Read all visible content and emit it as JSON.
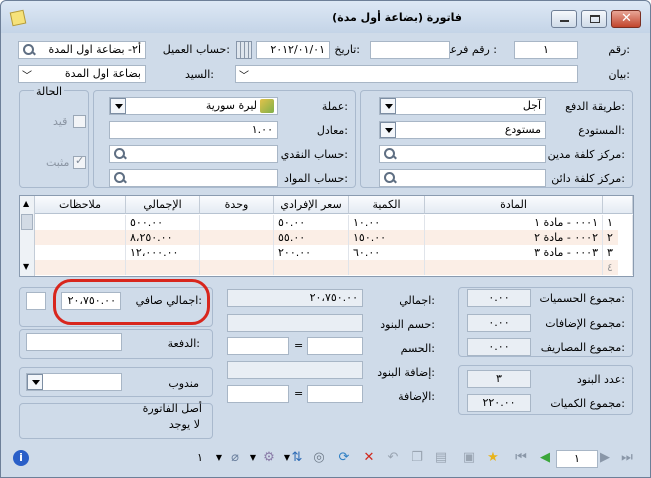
{
  "window": {
    "title": "فاتورة (بضاعة أول مدة)"
  },
  "header": {
    "number_label": "رقم:",
    "number_value": "١",
    "subnumber_label": "رقم فرعي :",
    "subnumber_value": "",
    "date_label": "تاريخ:",
    "date_value": "٢٠١٢/٠١/٠١",
    "client_label": "حساب العميل:",
    "client_value": "أ٢- بضاعة اول المدة",
    "statement_label": "بيان:",
    "statement_value": "",
    "mr_label": "السيد:",
    "mr_value": "بضاعة اول المدة"
  },
  "details": {
    "payment_method_label": "طريقة الدفع:",
    "payment_method_value": "آجل",
    "warehouse_label": "المستودع:",
    "warehouse_value": "مستودع",
    "debit_cost_center_label": "مركز كلفة مدين:",
    "credit_cost_center_label": "مركز كلفة دائن:",
    "currency_label": "عملة:",
    "currency_value": "ليرة سورية",
    "rate_label": "معادل:",
    "rate_value": "١.٠٠",
    "cash_account_label": "حساب النقدي:",
    "materials_account_label": "حساب المواد:"
  },
  "status": {
    "title": "الحالة",
    "registered_label": "قيد",
    "posted_label": "مثبت"
  },
  "table": {
    "columns": [
      "المادة",
      "الكمية",
      "سعر الإفرادي",
      "وحدة",
      "الإجمالي",
      "ملاحظات"
    ],
    "rows": [
      {
        "num": "١",
        "item": "٠٠٠١ - مادة ١",
        "qty": "١٠.٠٠",
        "price": "٥٠.٠٠",
        "unit": "",
        "total": "٥٠٠.٠٠",
        "notes": ""
      },
      {
        "num": "٢",
        "item": "٠٠٠٢ - مادة ٢",
        "qty": "١٥٠.٠٠",
        "price": "٥٥.٠٠",
        "unit": "",
        "total": "٨،٢٥٠.٠٠",
        "notes": ""
      },
      {
        "num": "٣",
        "item": "٠٠٠٣ - مادة ٣",
        "qty": "٦٠.٠٠",
        "price": "٢٠٠.٠٠",
        "unit": "",
        "total": "١٢،٠٠٠.٠٠",
        "notes": ""
      },
      {
        "num": "٤",
        "item": "",
        "qty": "",
        "price": "",
        "unit": "",
        "total": "",
        "notes": ""
      }
    ]
  },
  "totals": {
    "discounts_label": "مجموع الحسميات:",
    "discounts_value": "٠.٠٠",
    "additions_label": "مجموع الإضافات:",
    "additions_value": "٠.٠٠",
    "expenses_label": "مجموع المصاريف:",
    "expenses_value": "٠.٠٠",
    "items_count_label": "عدد البنود:",
    "items_count_value": "٣",
    "quantities_label": "مجموع الكميات:",
    "quantities_value": "٢٢٠.٠٠",
    "gross_label": "اجمالي:",
    "gross_value": "٢٠،٧٥٠.٠٠",
    "item_discount_label": "حسم البنود:",
    "discount_label": "الحسم:",
    "item_addition_label": "إضافة البنود:",
    "addition_label": "الإضافة:",
    "equals": "=",
    "net_label": "اجمالي صافي:",
    "net_value": "٢٠،٧٥٠.٠٠",
    "payment_label": "الدفعة:",
    "delegate_label": "مندوب",
    "origin_label": "أصل الفاتورة",
    "origin_value": "لا يوجد"
  },
  "toolbar": {
    "page_value": "١",
    "count_value": "١"
  },
  "colors": {
    "accent_red": "#d8261d",
    "row_alt": "#fbeee6"
  }
}
